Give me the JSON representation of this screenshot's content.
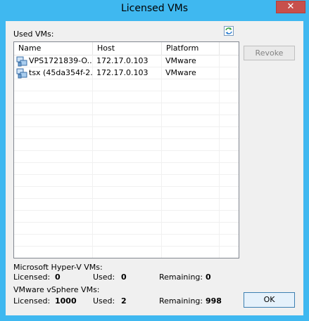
{
  "window": {
    "title": "Licensed VMs",
    "close_glyph": "✕"
  },
  "used_vms_label": "Used VMs:",
  "table": {
    "columns": [
      "Name",
      "Host",
      "Platform"
    ],
    "rows": [
      {
        "name": "VPS1721839-O...",
        "host": "172.17.0.103",
        "platform": "VMware",
        "icon": "vm-icon"
      },
      {
        "name": "tsx (45da354f-2...",
        "host": "172.17.0.103",
        "platform": "VMware",
        "icon": "vm-icon"
      }
    ]
  },
  "buttons": {
    "revoke": "Revoke",
    "ok": "OK",
    "refresh_icon": "refresh-icon"
  },
  "hyperv": {
    "title": "Microsoft Hyper-V VMs:",
    "licensed_label": "Licensed:",
    "licensed": "0",
    "used_label": "Used:",
    "used": "0",
    "remaining_label": "Remaining:",
    "remaining": "0"
  },
  "vsphere": {
    "title": "VMware vSphere VMs:",
    "licensed_label": "Licensed:",
    "licensed": "1000",
    "used_label": "Used:",
    "used": "2",
    "remaining_label": "Remaining:",
    "remaining": "998"
  },
  "colors": {
    "titlebar": "#3fb8f0",
    "close": "#c7504c",
    "dialog_bg": "#f0f0f0"
  }
}
